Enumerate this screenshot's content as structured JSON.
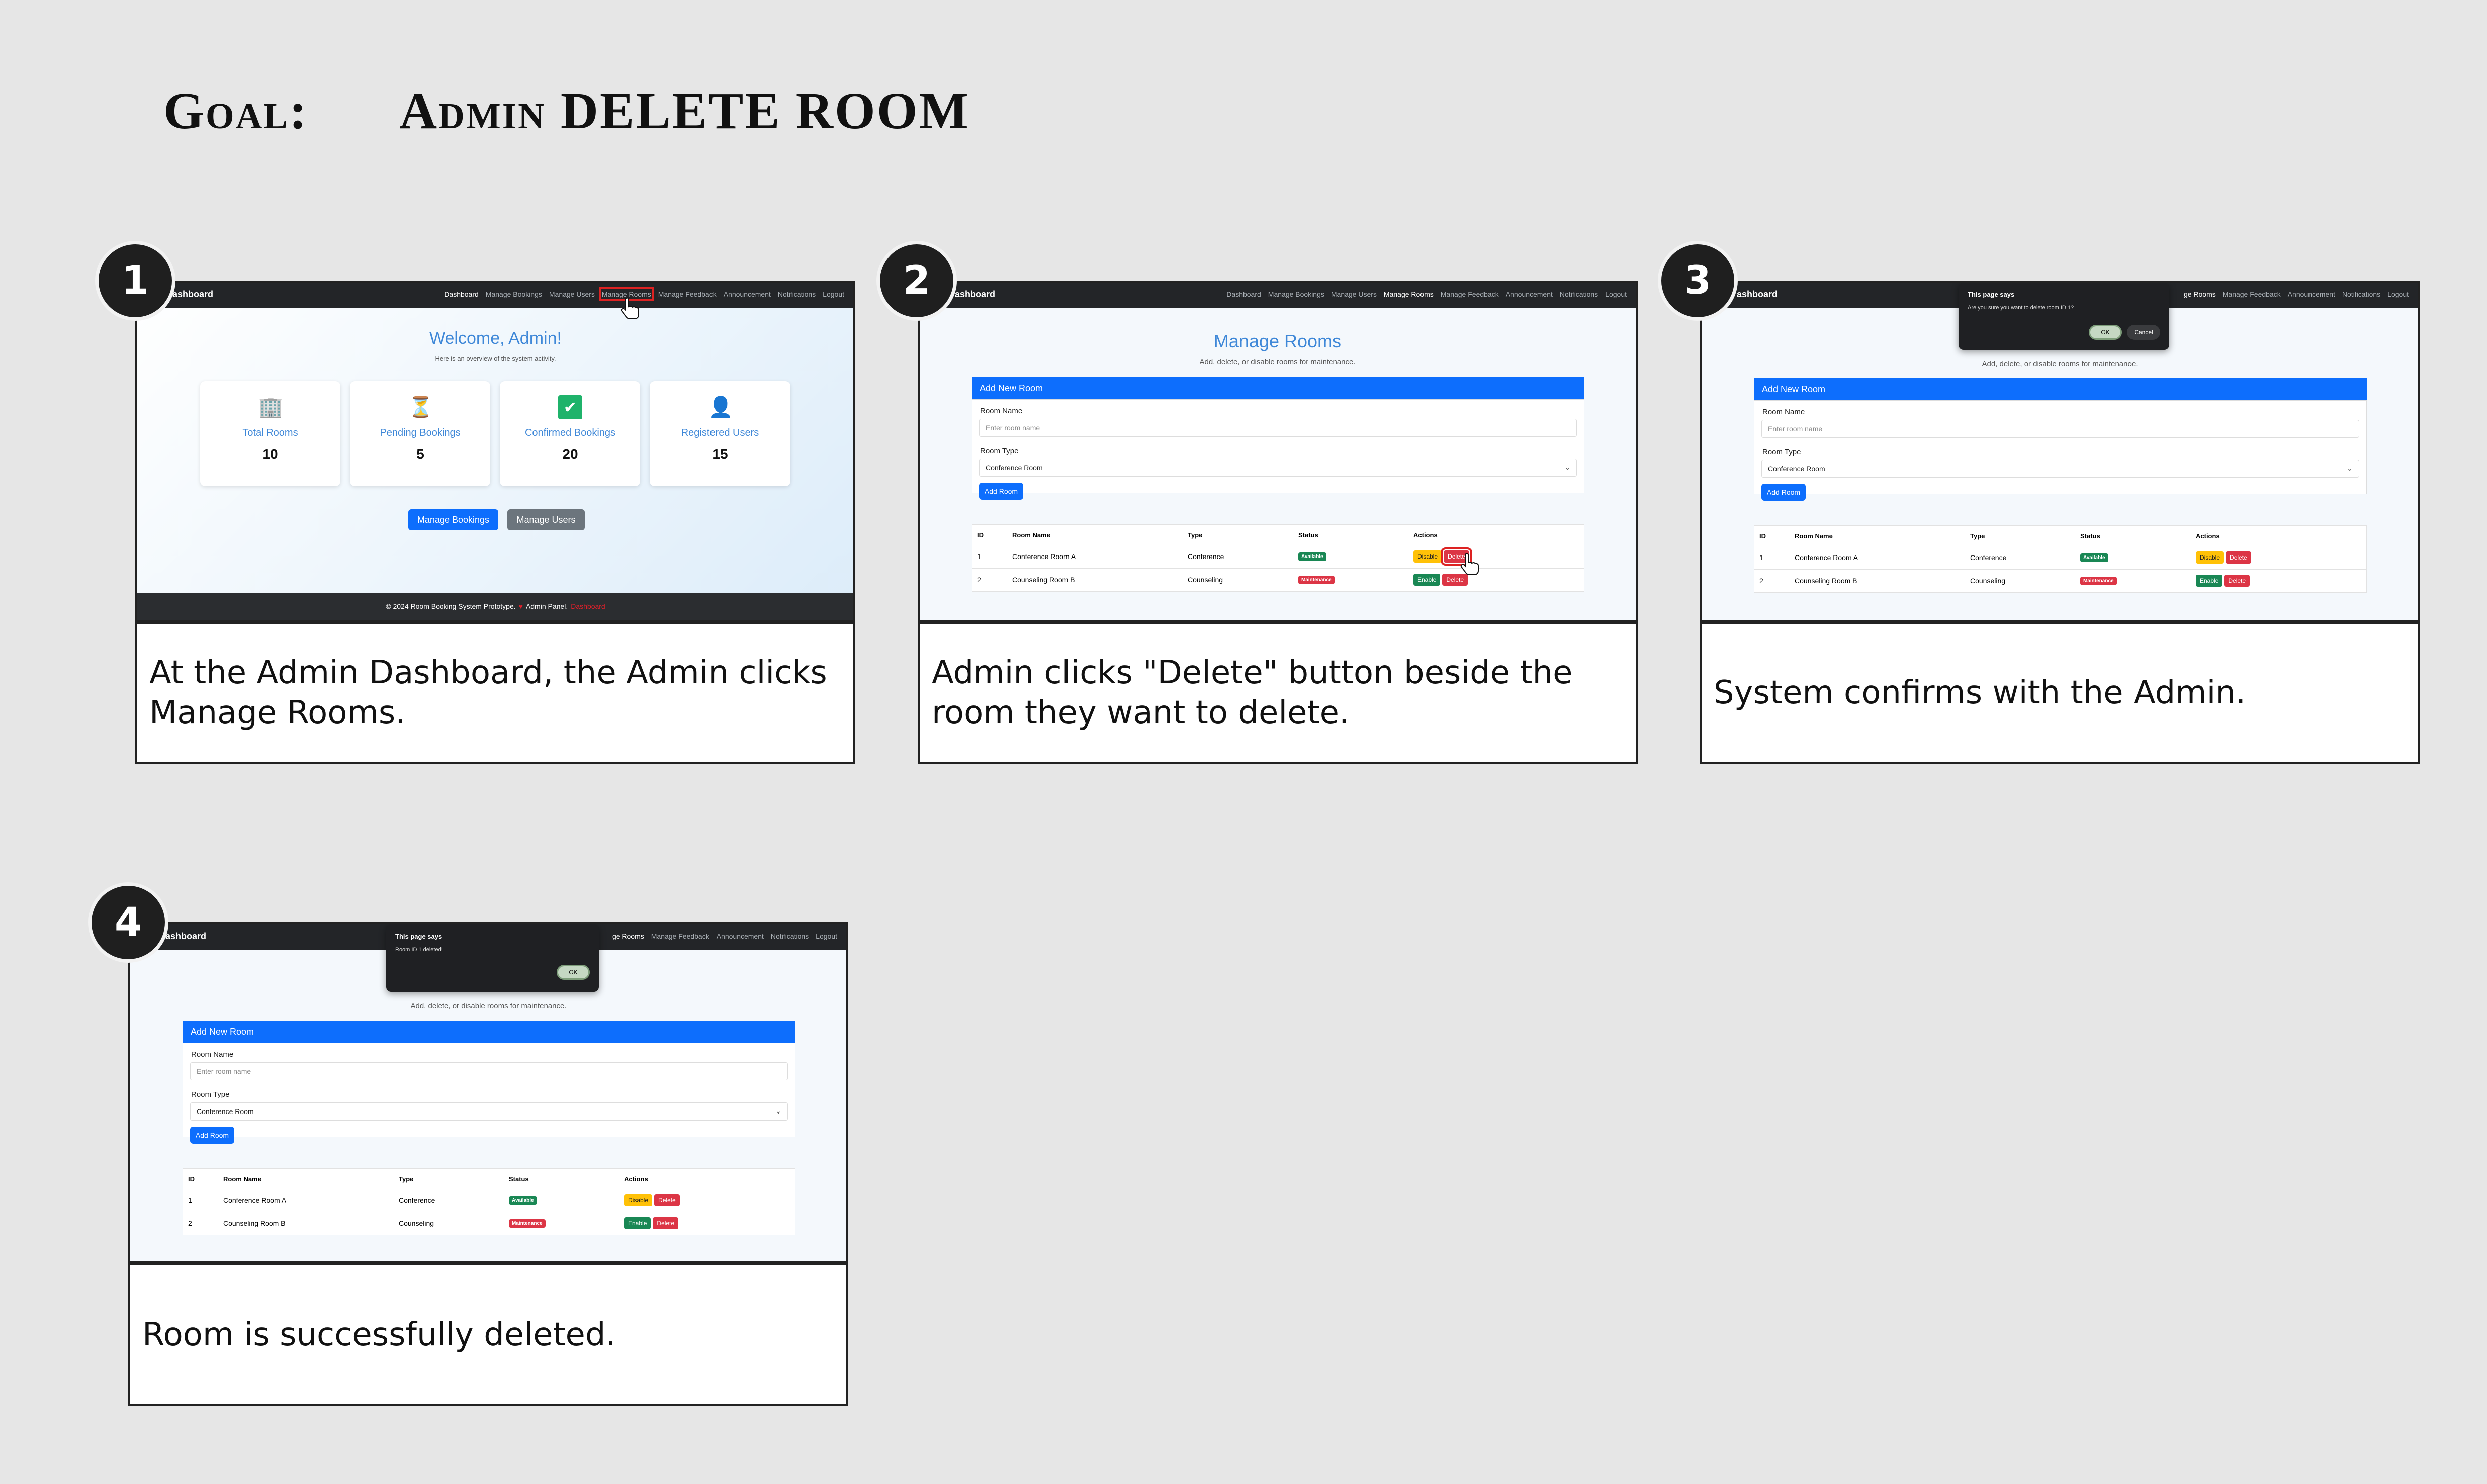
{
  "title": {
    "goal_label": "Goal:",
    "goal_text": "Admin DELETE ROOM"
  },
  "steps": [
    {
      "number": "1",
      "caption": "At the Admin Dashboard, the Admin clicks Manage Rooms."
    },
    {
      "number": "2",
      "caption": "Admin clicks \"Delete\" button beside the room they want to delete."
    },
    {
      "number": "3",
      "caption": "System confirms with the Admin."
    },
    {
      "number": "4",
      "caption": "Room is successfully deleted."
    }
  ],
  "nav": {
    "brand": "Dashboard",
    "brand_cropped": "ashboard",
    "links": [
      "Dashboard",
      "Manage Bookings",
      "Manage Users",
      "Manage Rooms",
      "Manage Feedback",
      "Announcement",
      "Notifications",
      "Logout"
    ],
    "links_cropped3": [
      "ge Rooms",
      "Manage Feedback",
      "Announcement",
      "Notifications",
      "Logout"
    ],
    "links_cropped4": [
      "ge Rooms",
      "Manage Feedback",
      "Announcement",
      "Notifications",
      "Logout"
    ]
  },
  "dashboard": {
    "welcome": "Welcome, Admin!",
    "subtitle": "Here is an overview of the system activity.",
    "stats": [
      {
        "label": "Total Rooms",
        "value": "10",
        "icon": "building-icon",
        "glyph": "🏢"
      },
      {
        "label": "Pending Bookings",
        "value": "5",
        "icon": "hourglass-icon",
        "glyph": "⏳"
      },
      {
        "label": "Confirmed Bookings",
        "value": "20",
        "icon": "check-box-icon",
        "glyph": "✔"
      },
      {
        "label": "Registered Users",
        "value": "15",
        "icon": "user-icon",
        "glyph": "👤"
      }
    ],
    "btn_bookings": "Manage Bookings",
    "btn_users": "Manage Users",
    "footer_text": "© 2024 Room Booking System Prototype.",
    "footer_heart": "♥",
    "footer_admin": "Admin Panel.",
    "footer_link": "Dashboard"
  },
  "rooms": {
    "title": "Manage Rooms",
    "subtitle": "Add, delete, or disable rooms for maintenance.",
    "card_header": "Add New Room",
    "name_label": "Room Name",
    "name_placeholder": "Enter room name",
    "type_label": "Room Type",
    "type_value": "Conference Room",
    "chevron": "⌄",
    "add_button": "Add Room",
    "columns": [
      "ID",
      "Room Name",
      "Type",
      "Status",
      "Actions"
    ],
    "rows": [
      {
        "id": "1",
        "name": "Conference Room A",
        "type": "Conference",
        "status": "Available",
        "toggle": "Disable",
        "delete": "Delete"
      },
      {
        "id": "2",
        "name": "Counseling Room B",
        "type": "Counseling",
        "status": "Maintenance",
        "toggle": "Enable",
        "delete": "Delete"
      }
    ]
  },
  "confirm_dialog": {
    "title": "This page says",
    "message": "Are you sure you want to delete room ID 1?",
    "ok": "OK",
    "cancel": "Cancel"
  },
  "deleted_dialog": {
    "title": "This page says",
    "message": "Room ID 1 deleted!",
    "ok": "OK"
  }
}
